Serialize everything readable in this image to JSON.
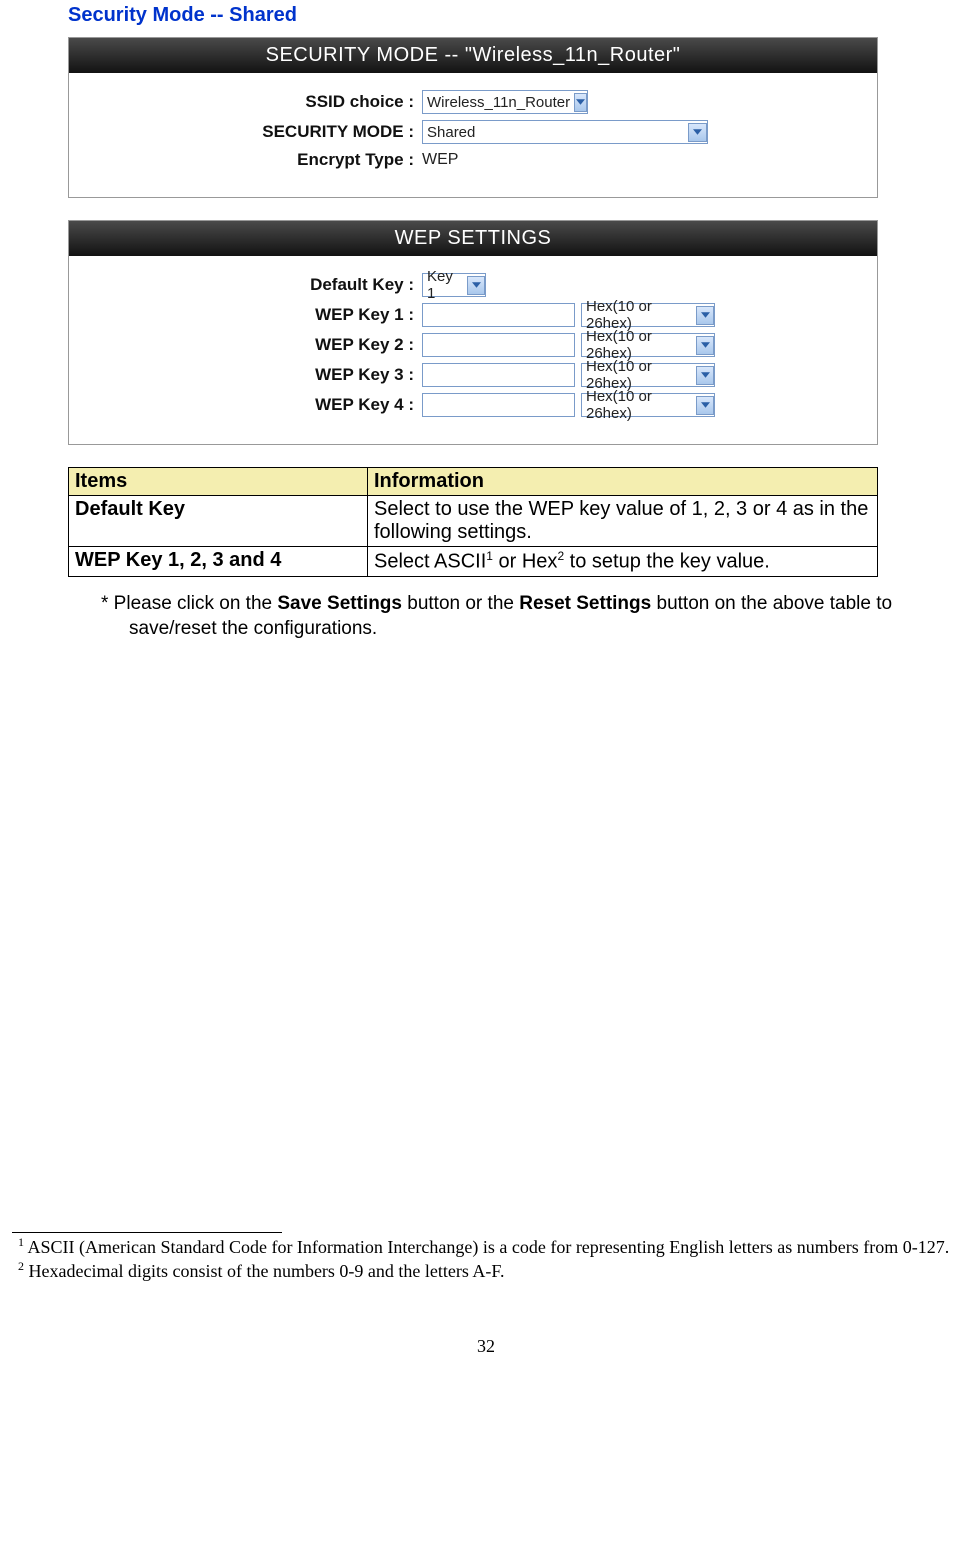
{
  "title": "Security Mode -- Shared",
  "panel1": {
    "header": "SECURITY MODE -- \"Wireless_11n_Router\"",
    "ssid_label": "SSID choice :",
    "ssid_value": "Wireless_11n_Router",
    "mode_label": "SECURITY MODE :",
    "mode_value": "Shared",
    "encrypt_label": "Encrypt Type :",
    "encrypt_value": "WEP"
  },
  "panel2": {
    "header": "WEP SETTINGS",
    "default_key_label": "Default Key :",
    "default_key_value": "Key 1",
    "keys": [
      {
        "label": "WEP Key 1 :",
        "value": "",
        "format": "Hex(10 or 26hex)"
      },
      {
        "label": "WEP Key 2 :",
        "value": "",
        "format": "Hex(10 or 26hex)"
      },
      {
        "label": "WEP Key 3 :",
        "value": "",
        "format": "Hex(10 or 26hex)"
      },
      {
        "label": "WEP Key 4 :",
        "value": "",
        "format": "Hex(10 or 26hex)"
      }
    ]
  },
  "info_table": {
    "header_items": "Items",
    "header_info": "Information",
    "rows": [
      {
        "item": "Default Key",
        "info": "Select to use the WEP key value of 1, 2, 3 or 4 as in the following settings."
      },
      {
        "item": "WEP Key 1, 2, 3 and 4",
        "info_pre": "Select ASCII",
        "sup1": "1",
        "info_mid": " or Hex",
        "sup2": "2",
        "info_post": " to setup the key value."
      }
    ]
  },
  "note": {
    "prefix": "* Please click on the ",
    "bold1": "Save Settings",
    "mid": " button or the ",
    "bold2": "Reset Settings",
    "suffix": " button on the above table to save/reset the configurations."
  },
  "footnotes": {
    "f1_sup": "1",
    "f1": " ASCII (American Standard Code for Information Interchange) is a code for representing English letters as numbers from 0-127.",
    "f2_sup": "2",
    "f2": " Hexadecimal digits consist of the numbers 0-9 and the letters A-F."
  },
  "page_number": "32"
}
